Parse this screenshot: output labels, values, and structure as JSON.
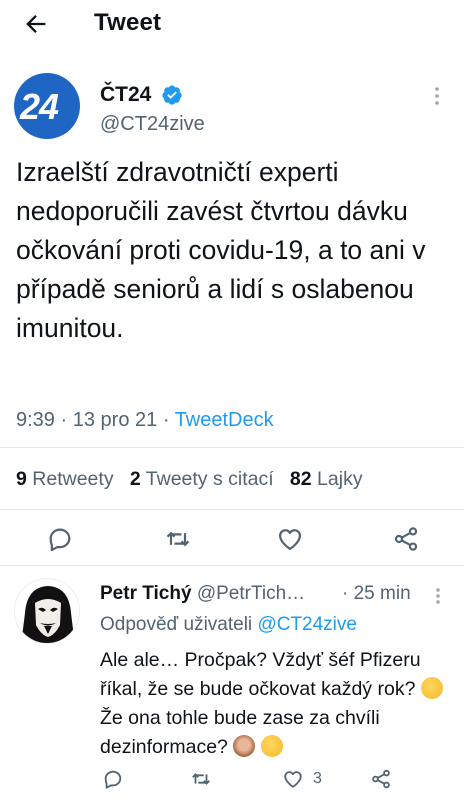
{
  "header": {
    "title": "Tweet",
    "back_icon": "arrow-left-icon"
  },
  "tweet": {
    "avatar_text": "24",
    "display_name": "ČT24",
    "handle": "@CT24zive",
    "text": "Izraelští zdravotničtí experti nedoporučili zavést čtvrtou dávku očkování proti covidu-19, a to ani v případě seniorů a lidí s oslabenou imunitou.",
    "time": "9:39",
    "sep1": "·",
    "date": "13 pro 21",
    "sep2": "·",
    "source": "TweetDeck",
    "stats": {
      "retweets_count": "9",
      "retweets_label": "Retweety",
      "quotes_count": "2",
      "quotes_label": "Tweety s citací",
      "likes_count": "82",
      "likes_label": "Lajky"
    }
  },
  "reply": {
    "name": "Petr Tichý",
    "handle": "@PetrTich…",
    "time": "· 25 min",
    "replying_prefix": "Odpověď uživateli",
    "replying_mention": "@CT24zive",
    "text_part1": "Ale ale… Pročpak? Vždyť šéf Pfizeru říkal, že se bude očkovat každý rok?",
    "text_part2": "Že ona tohle bude zase za chvíli dezinformace?",
    "like_count": "3"
  },
  "colors": {
    "accent": "#1d9bf0",
    "secondary": "#536471",
    "primary_text": "#0f1419",
    "avatar_bg": "#1f66c4"
  }
}
